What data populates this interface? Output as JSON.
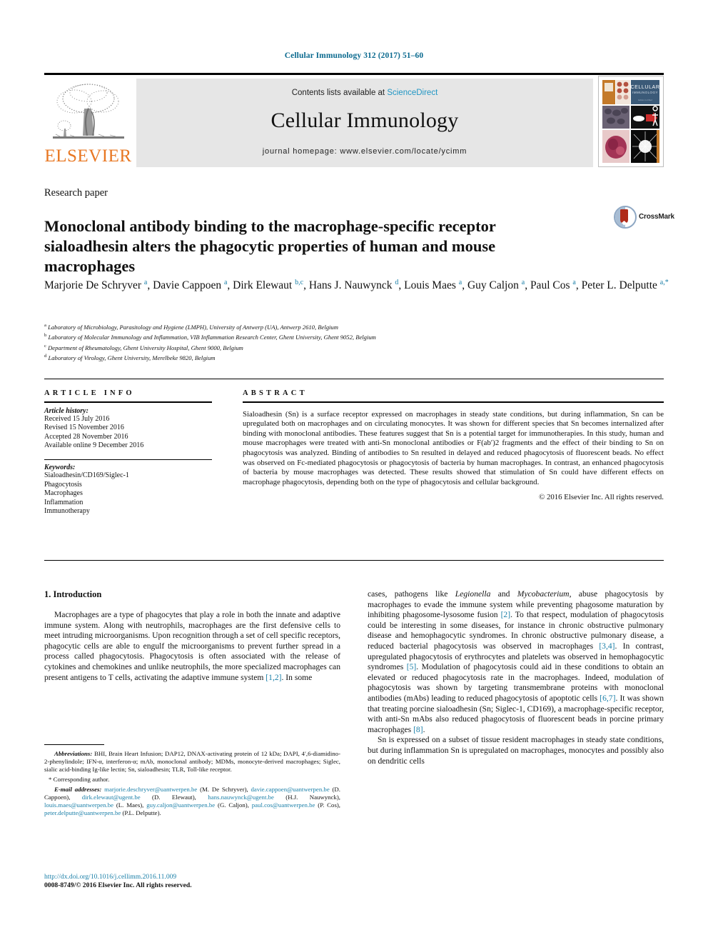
{
  "running_head": "Cellular Immunology 312 (2017) 51–60",
  "masthead": {
    "contents_prefix": "Contents lists available at ",
    "sciencedirect": "ScienceDirect",
    "journal_title": "Cellular Immunology",
    "homepage": "journal homepage: www.elsevier.com/locate/ycimm",
    "publisher": "ELSEVIER",
    "cover_title_line1": "CELLULAR",
    "cover_title_line2": "IMMUNOLOGY"
  },
  "article": {
    "type": "Research paper",
    "title": "Monoclonal antibody binding to the macrophage-specific receptor sialoadhesin alters the phagocytic properties of human and mouse macrophages",
    "crossmark_label": "CrossMark",
    "authors_html": "Marjorie De Schryver <sup>a</sup>, Davie Cappoen <sup>a</sup>, Dirk Elewaut <sup>b,c</sup>, Hans J. Nauwynck <sup>d</sup>, Louis Maes <sup>a</sup>, Guy Caljon <sup>a</sup>, Paul Cos <sup>a</sup>, Peter L. Delputte <sup>a,*</sup>",
    "affiliations": [
      {
        "marker": "a",
        "text": "Laboratory of Microbiology, Parasitology and Hygiene (LMPH), University of Antwerp (UA), Antwerp 2610, Belgium"
      },
      {
        "marker": "b",
        "text": "Laboratory of Molecular Immunology and Inflammation, VIB Inflammation Research Center, Ghent University, Ghent 9052, Belgium"
      },
      {
        "marker": "c",
        "text": "Department of Rheumatology, Ghent University Hospital, Ghent 9000, Belgium"
      },
      {
        "marker": "d",
        "text": "Laboratory of Virology, Ghent University, Merelbeke 9820, Belgium"
      }
    ]
  },
  "article_info": {
    "heading": "ARTICLE INFO",
    "history_label": "Article history:",
    "history": [
      "Received 15 July 2016",
      "Revised 15 November 2016",
      "Accepted 28 November 2016",
      "Available online 9 December 2016"
    ],
    "keywords_label": "Keywords:",
    "keywords": [
      "Sialoadhesin/CD169/Siglec-1",
      "Phagocytosis",
      "Macrophages",
      "Inflammation",
      "Immunotherapy"
    ]
  },
  "abstract": {
    "heading": "ABSTRACT",
    "text": "Sialoadhesin (Sn) is a surface receptor expressed on macrophages in steady state conditions, but during inflammation, Sn can be upregulated both on macrophages and on circulating monocytes. It was shown for different species that Sn becomes internalized after binding with monoclonal antibodies. These features suggest that Sn is a potential target for immunotherapies. In this study, human and mouse macrophages were treated with anti-Sn monoclonal antibodies or F(ab′)2 fragments and the effect of their binding to Sn on phagocytosis was analyzed. Binding of antibodies to Sn resulted in delayed and reduced phagocytosis of fluorescent beads. No effect was observed on Fc-mediated phagocytosis or phagocytosis of bacteria by human macrophages. In contrast, an enhanced phagocytosis of bacteria by mouse macrophages was detected. These results showed that stimulation of Sn could have different effects on macrophage phagocytosis, depending both on the type of phagocytosis and cellular background.",
    "copyright": "© 2016 Elsevier Inc. All rights reserved."
  },
  "body": {
    "section1_heading": "1. Introduction",
    "left_paragraph": "Macrophages are a type of phagocytes that play a role in both the innate and adaptive immune system. Along with neutrophils, macrophages are the first defensive cells to meet intruding microorganisms. Upon recognition through a set of cell specific receptors, phagocytic cells are able to engulf the microorganisms to prevent further spread in a process called phagocytosis. Phagocytosis is often associated with the release of cytokines and chemokines and unlike neutrophils, the more specialized macrophages can present antigens to T cells, activating the adaptive immune system [1,2]. In some",
    "right_paragraph_1": "cases, pathogens like Legionella and Mycobacterium, abuse phagocytosis by macrophages to evade the immune system while preventing phagosome maturation by inhibiting phagosome-lysosome fusion [2]. To that respect, modulation of phagocytosis could be interesting in some diseases, for instance in chronic obstructive pulmonary disease and hemophagocytic syndromes. In chronic obstructive pulmonary disease, a reduced bacterial phagocytosis was observed in macrophages [3,4]. In contrast, upregulated phagocytosis of erythrocytes and platelets was observed in hemophagocytic syndromes [5]. Modulation of phagocytosis could aid in these conditions to obtain an elevated or reduced phagocytosis rate in the macrophages. Indeed, modulation of phagocytosis was shown by targeting transmembrane proteins with monoclonal antibodies (mAbs) leading to reduced phagocytosis of apoptotic cells [6,7]. It was shown that treating porcine sialoadhesin (Sn; Siglec-1, CD169), a macrophage-specific receptor, with anti-Sn mAbs also reduced phagocytosis of fluorescent beads in porcine primary macrophages [8].",
    "right_paragraph_2": "Sn is expressed on a subset of tissue resident macrophages in steady state conditions, but during inflammation Sn is upregulated on macrophages, monocytes and possibly also on dendritic cells"
  },
  "footnotes": {
    "abbreviations_label": "Abbreviations:",
    "abbreviations_text": "BHI, Brain Heart Infusion; DAP12, DNAX-activating protein of 12 kDa; DAPI, 4′,6-diamidino-2-phenylindole; IFN-α, interferon-α; mAb, monoclonal antibody; MDMs, monocyte-derived macrophages; Siglec, sialic acid-binding Ig-like lectin; Sn, sialoadhesin; TLR, Toll-like receptor.",
    "corresponding": "* Corresponding author.",
    "email_label": "E-mail addresses:",
    "emails": [
      {
        "address": "marjorie.deschryver@uantwerpen.be",
        "name": "(M. De Schryver)"
      },
      {
        "address": "davie.cappoen@uantwerpen.be",
        "name": "(D. Cappoen)"
      },
      {
        "address": "dirk.elewaut@ugent.be",
        "name": "(D. Elewaut)"
      },
      {
        "address": "hans.nauwynck@ugent.be",
        "name": "(H.J. Nauwynck)"
      },
      {
        "address": "louis.maes@uantwerpen.be",
        "name": "(L. Maes)"
      },
      {
        "address": "guy.caljon@uantwerpen.be",
        "name": "(G. Caljon)"
      },
      {
        "address": "paul.cos@uantwerpen.be",
        "name": "(P. Cos)"
      },
      {
        "address": "peter.delputte@uantwerpen.be",
        "name": "(P.L. Delputte)"
      }
    ]
  },
  "footer": {
    "doi": "http://dx.doi.org/10.1016/j.cellimm.2016.11.009",
    "issn_copyright": "0008-8749/© 2016 Elsevier Inc. All rights reserved."
  },
  "colors": {
    "link": "#1a7fa8",
    "runhead": "#0b6a8f",
    "elsevier_orange": "#E87722",
    "band_grey": "#e6e6e6"
  }
}
